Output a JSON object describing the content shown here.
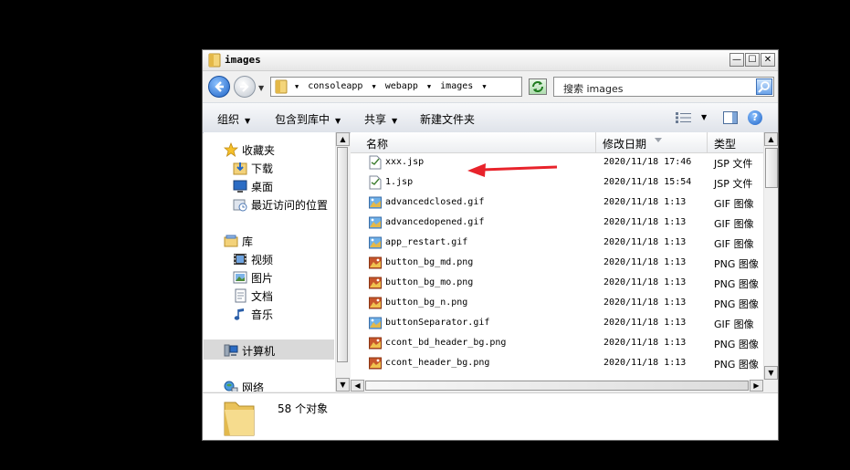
{
  "window": {
    "title": "images",
    "controls": [
      "minimize-icon",
      "maximize-icon",
      "close-icon"
    ]
  },
  "address": {
    "crumbs": [
      "consoleapp",
      "webapp",
      "images"
    ],
    "search_placeholder": "搜索 images"
  },
  "toolbar": {
    "organize": "组织",
    "include_in_library": "包含到库中",
    "share": "共享",
    "new_folder": "新建文件夹"
  },
  "nav": {
    "favorites": {
      "label": "收藏夹",
      "icon": "star-icon",
      "items": [
        {
          "label": "下载",
          "icon": "downloads-icon"
        },
        {
          "label": "桌面",
          "icon": "desktop-icon"
        },
        {
          "label": "最近访问的位置",
          "icon": "recent-places-icon"
        }
      ]
    },
    "libraries": {
      "label": "库",
      "icon": "library-icon",
      "items": [
        {
          "label": "视频",
          "icon": "video-icon"
        },
        {
          "label": "图片",
          "icon": "pictures-icon"
        },
        {
          "label": "文档",
          "icon": "documents-icon"
        },
        {
          "label": "音乐",
          "icon": "music-icon"
        }
      ]
    },
    "computer": {
      "label": "计算机",
      "icon": "computer-icon"
    },
    "network": {
      "label": "网络",
      "icon": "network-icon"
    }
  },
  "columns": {
    "name": "名称",
    "modified": "修改日期",
    "type": "类型"
  },
  "files": [
    {
      "name": "xxx.jsp",
      "date": "2020/11/18 17:46",
      "type": "JSP 文件",
      "icon": "jsp-file-icon"
    },
    {
      "name": "1.jsp",
      "date": "2020/11/18 15:54",
      "type": "JSP 文件",
      "icon": "jsp-file-icon"
    },
    {
      "name": "advancedclosed.gif",
      "date": "2020/11/18 1:13",
      "type": "GIF 图像",
      "icon": "gif-image-icon"
    },
    {
      "name": "advancedopened.gif",
      "date": "2020/11/18 1:13",
      "type": "GIF 图像",
      "icon": "gif-image-icon"
    },
    {
      "name": "app_restart.gif",
      "date": "2020/11/18 1:13",
      "type": "GIF 图像",
      "icon": "gif-image-icon"
    },
    {
      "name": "button_bg_md.png",
      "date": "2020/11/18 1:13",
      "type": "PNG 图像",
      "icon": "png-image-icon"
    },
    {
      "name": "button_bg_mo.png",
      "date": "2020/11/18 1:13",
      "type": "PNG 图像",
      "icon": "png-image-icon"
    },
    {
      "name": "button_bg_n.png",
      "date": "2020/11/18 1:13",
      "type": "PNG 图像",
      "icon": "png-image-icon"
    },
    {
      "name": "buttonSeparator.gif",
      "date": "2020/11/18 1:13",
      "type": "GIF 图像",
      "icon": "gif-image-icon"
    },
    {
      "name": "ccont_bd_header_bg.png",
      "date": "2020/11/18 1:13",
      "type": "PNG 图像",
      "icon": "png-image-icon"
    },
    {
      "name": "ccont_header_bg.png",
      "date": "2020/11/18 1:13",
      "type": "PNG 图像",
      "icon": "png-image-icon"
    }
  ],
  "status": {
    "count_text": "58 个对象"
  },
  "colors": {
    "selection": "#d9d9d9",
    "accent_blue": "#1e63c6",
    "annotation_arrow": "#e8232b"
  }
}
